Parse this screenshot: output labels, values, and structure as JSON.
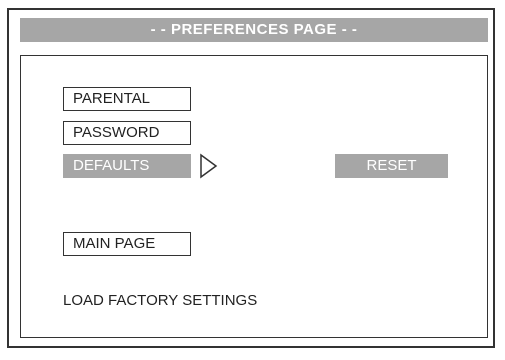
{
  "header": {
    "title": "- - PREFERENCES PAGE - -"
  },
  "menu": {
    "items": [
      {
        "label": "PARENTAL",
        "selected": false
      },
      {
        "label": "PASSWORD",
        "selected": false
      },
      {
        "label": "DEFAULTS",
        "selected": true
      },
      {
        "label": "MAIN PAGE",
        "selected": false
      }
    ]
  },
  "submenu": {
    "reset_label": "RESET",
    "arrow_icon": "triangle-right-icon"
  },
  "info": {
    "text": "LOAD FACTORY SETTINGS"
  },
  "colors": {
    "highlight": "#a6a6a6",
    "border": "#333333",
    "background": "#ffffff",
    "text": "#222222"
  }
}
